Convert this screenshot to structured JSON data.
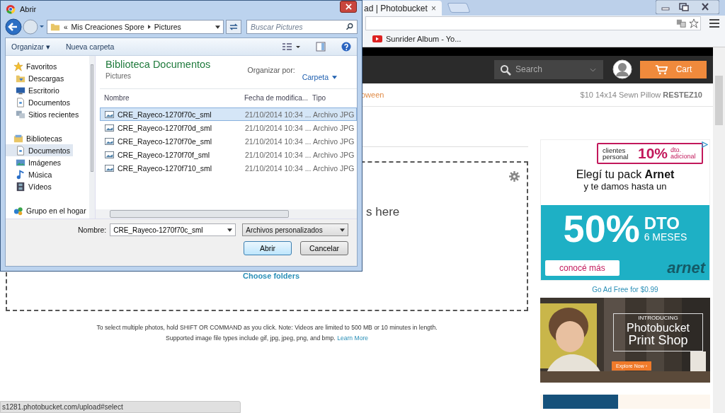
{
  "browser": {
    "tab": {
      "title": "ad | Photobucket",
      "close": "×"
    },
    "bookmarks": [
      {
        "label": "Sunrider Album - Yo..."
      }
    ],
    "status_bar": "s1281.photobucket.com/upload#select"
  },
  "site_header": {
    "search": {
      "placeholder": "Search"
    },
    "cart": "Cart"
  },
  "promo_bar": {
    "left": "oween",
    "right": "$10 14x14 Sewn Pillow **RESTEZ10**"
  },
  "upload": {
    "drop_text": "s here",
    "choose_folders": "Choose folders",
    "note": "To select multiple photos, hold SHIFT OR COMMAND as you click. Note: Videos are limited to 500 MB or 10 minutes in length.",
    "types": "Supported image file types include gif, jpg, jpeg, png, and bmp.",
    "learn_more": "Learn More"
  },
  "ads": {
    "arnet": {
      "badge_left": "clientes personal",
      "badge_big": "10%",
      "badge_right": "dto. adicional",
      "headline": "Elegí tu pack **Arnet**",
      "subline": "y te damos hasta un",
      "big": "50%",
      "dto": "DTO",
      "months": "6 MESES",
      "cta": "conocé más",
      "logo": "arnet"
    },
    "ad_free": "Go Ad Free for $0.99",
    "print": {
      "kicker": "INTRODUCING",
      "line1": "Photobucket",
      "line2": "Print Shop",
      "cta": "Explore Now ›"
    }
  },
  "dialog": {
    "title": "Abrir",
    "breadcrumb_prefix": "«",
    "breadcrumb": [
      "Mis Creaciones Spore",
      "Pictures"
    ],
    "search": {
      "placeholder": "Buscar Pictures"
    },
    "toolbar": {
      "organize": "Organizar ▾",
      "new_folder": "Nueva carpeta"
    },
    "nav": [
      {
        "label": "Favoritos",
        "selected": false,
        "children": [
          {
            "label": "Descargas",
            "selected": false
          },
          {
            "label": "Escritorio",
            "selected": false
          },
          {
            "label": "Documentos",
            "selected": false
          },
          {
            "label": "Sitios recientes",
            "selected": false
          }
        ]
      },
      {
        "label": "Bibliotecas",
        "selected": false,
        "children": [
          {
            "label": "Documentos",
            "selected": true
          },
          {
            "label": "Imágenes",
            "selected": false
          },
          {
            "label": "Música",
            "selected": false
          },
          {
            "label": "Vídeos",
            "selected": false
          }
        ]
      },
      {
        "label": "Grupo en el hogar",
        "selected": false
      }
    ],
    "library": {
      "title": "Biblioteca Documentos",
      "subtitle": "Pictures",
      "arrange_label": "Organizar por:",
      "arrange_value": "Carpeta"
    },
    "columns": [
      "Nombre",
      "Fecha de modifica...",
      "Tipo"
    ],
    "files": [
      {
        "name": "CRE_Rayeco-1270f70c_sml",
        "date": "21/10/2014 10:34 ...",
        "type": "Archivo JPG",
        "selected": true
      },
      {
        "name": "CRE_Rayeco-1270f70d_sml",
        "date": "21/10/2014 10:34 ...",
        "type": "Archivo JPG",
        "selected": false
      },
      {
        "name": "CRE_Rayeco-1270f70e_sml",
        "date": "21/10/2014 10:34 ...",
        "type": "Archivo JPG",
        "selected": false
      },
      {
        "name": "CRE_Rayeco-1270f70f_sml",
        "date": "21/10/2014 10:34 ...",
        "type": "Archivo JPG",
        "selected": false
      },
      {
        "name": "CRE_Rayeco-1270f710_sml",
        "date": "21/10/2014 10:34 ...",
        "type": "Archivo JPG",
        "selected": false
      }
    ],
    "filename_label": "Nombre:",
    "filename": "CRE_Rayeco-1270f70c_sml",
    "filter": "Archivos personalizados",
    "open": "Abrir",
    "cancel": "Cancelar"
  }
}
